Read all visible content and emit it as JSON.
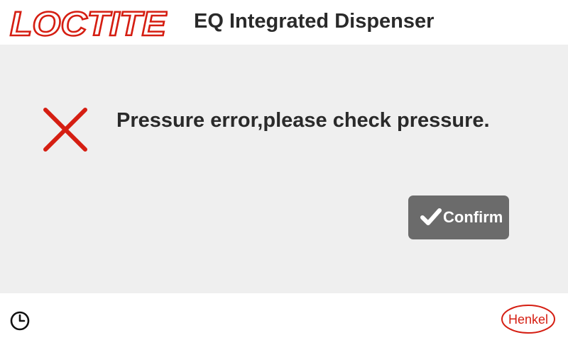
{
  "header": {
    "brand_logo_text": "LOCTITE",
    "title": "EQ Integrated Dispenser"
  },
  "dialog": {
    "message": "Pressure error,please check pressure.",
    "status_icon": "error-x-icon",
    "confirm_label": "Confirm",
    "confirm_icon": "checkmark-icon"
  },
  "footer": {
    "clock_icon": "clock-icon",
    "company_logo_text": "Henkel"
  },
  "colors": {
    "brand_red": "#d51e12",
    "panel_bg": "#efefef",
    "button_bg": "#6b6b6b",
    "text_dark": "#2a2a2a",
    "button_text": "#ffffff"
  }
}
